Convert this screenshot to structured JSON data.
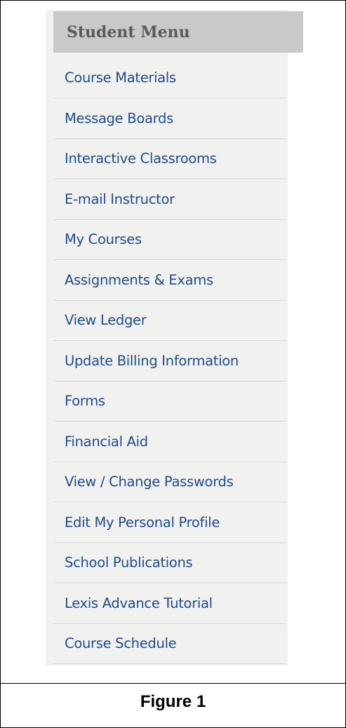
{
  "menu": {
    "title": "Student Menu",
    "items": [
      "Course Materials",
      "Message Boards",
      "Interactive Classrooms",
      "E-mail Instructor",
      "My Courses",
      "Assignments & Exams",
      "View Ledger",
      "Update Billing Information",
      "Forms",
      "Financial Aid",
      "View / Change Passwords",
      "Edit My Personal Profile",
      "School Publications",
      "Lexis Advance Tutorial",
      "Course Schedule"
    ]
  },
  "caption": "Figure 1",
  "colors": {
    "link": "#1d4c8c",
    "header_bg": "#c9c9c9",
    "header_text": "#5a5a5a",
    "panel_bg": "#f1f1f0",
    "divider": "#d9d9d9"
  }
}
